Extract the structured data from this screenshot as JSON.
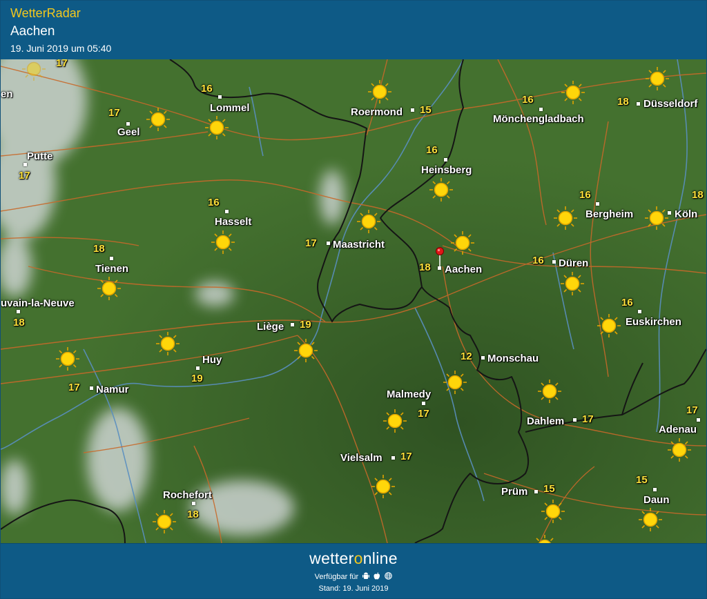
{
  "header": {
    "app_title": "WetterRadar",
    "location": "Aachen",
    "timestamp": "19. Juni 2019 um 05:40"
  },
  "map": {
    "selected_location": "Aachen",
    "places": [
      {
        "id": "lommel",
        "name": "Lommel",
        "temp": "16"
      },
      {
        "id": "geel",
        "name": "Geel",
        "temp": "17"
      },
      {
        "id": "roermond",
        "name": "Roermond",
        "temp": "15"
      },
      {
        "id": "moenchengladbach",
        "name": "Mönchengladbach",
        "temp": "16"
      },
      {
        "id": "duesseldorf",
        "name": "Düsseldorf",
        "temp": "18"
      },
      {
        "id": "putte",
        "name": "Putte",
        "temp": "17"
      },
      {
        "id": "heinsberg",
        "name": "Heinsberg",
        "temp": "16"
      },
      {
        "id": "hasselt",
        "name": "Hasselt",
        "temp": "16"
      },
      {
        "id": "bergheim",
        "name": "Bergheim",
        "temp": "16"
      },
      {
        "id": "koeln",
        "name": "Köln",
        "temp": "18"
      },
      {
        "id": "maastricht",
        "name": "Maastricht",
        "temp": "17"
      },
      {
        "id": "tienen",
        "name": "Tienen",
        "temp": "18"
      },
      {
        "id": "aachen",
        "name": "Aachen",
        "temp": "18"
      },
      {
        "id": "dueren",
        "name": "Düren",
        "temp": "16"
      },
      {
        "id": "louvain",
        "name": "uvain-la-Neuve",
        "temp": "18"
      },
      {
        "id": "euskirchen",
        "name": "Euskirchen",
        "temp": "16"
      },
      {
        "id": "liege",
        "name": "Liège",
        "temp": "19"
      },
      {
        "id": "huy",
        "name": "Huy",
        "temp": "19"
      },
      {
        "id": "monschau",
        "name": "Monschau",
        "temp": "12"
      },
      {
        "id": "namur",
        "name": "Namur",
        "temp": "17"
      },
      {
        "id": "malmedy",
        "name": "Malmedy",
        "temp": "17"
      },
      {
        "id": "dahlem",
        "name": "Dahlem",
        "temp": "17"
      },
      {
        "id": "adenau",
        "name": "Adenau",
        "temp": "17"
      },
      {
        "id": "vielsalm",
        "name": "Vielsalm",
        "temp": "17"
      },
      {
        "id": "rochefort",
        "name": "Rochefort",
        "temp": "18"
      },
      {
        "id": "pruem",
        "name": "Prüm",
        "temp": "15"
      },
      {
        "id": "daun",
        "name": "Daun",
        "temp": "15"
      }
    ],
    "edge_labels": [
      {
        "id": "top-left-temp",
        "temp": "17"
      },
      {
        "id": "left-en",
        "text": "en"
      }
    ],
    "weather_icon": "sun-icon"
  },
  "footer": {
    "brand_prefix": "wetter",
    "brand_o": "o",
    "brand_suffix": "nline",
    "available_label": "Verfügbar für",
    "platform_icons": [
      "android-icon",
      "apple-icon",
      "web-icon"
    ],
    "stand": "Stand: 19. Juni 2019"
  },
  "colors": {
    "header_bg": "#0e5a86",
    "accent_yellow": "#f2c81e",
    "map_green": "#3e6a2c",
    "road": "#c8692a",
    "river": "#5a8fc0",
    "border": "#111111"
  }
}
